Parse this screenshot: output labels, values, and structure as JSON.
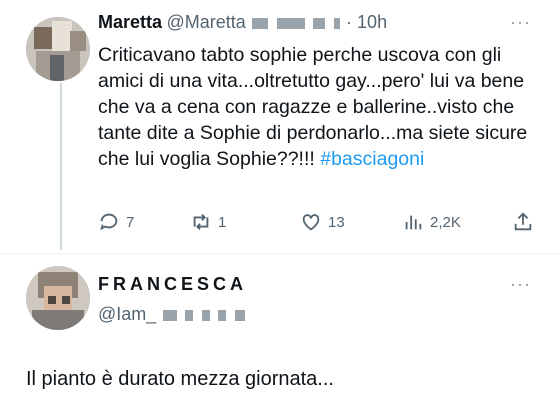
{
  "tweet1": {
    "name": "Maretta",
    "handle": "@Maretta",
    "time": "· 10h",
    "more_icon": "more-dots-icon",
    "text": "Criticavano tabto sophie perche uscova con gli amici di una vita...oltretutto gay...pero' lui va bene che va a cena con ragazze e ballerine..visto che tante dite a Sophie di perdonarlo...ma siete sicure che lui voglia Sophie??!!! ",
    "hashtag": "#basciagoni",
    "actions": {
      "reply": "7",
      "retweet": "1",
      "like": "13",
      "views": "2,2K"
    }
  },
  "tweet2": {
    "name": "FRANCESCA",
    "handle": "@Iam_",
    "more_icon": "more-dots-icon",
    "text": "Il pianto è durato mezza giornata..."
  },
  "colors": {
    "text": "#0f1419",
    "secondary": "#536471",
    "accent": "#1d9bf0",
    "thread_line": "#cfd9de"
  }
}
